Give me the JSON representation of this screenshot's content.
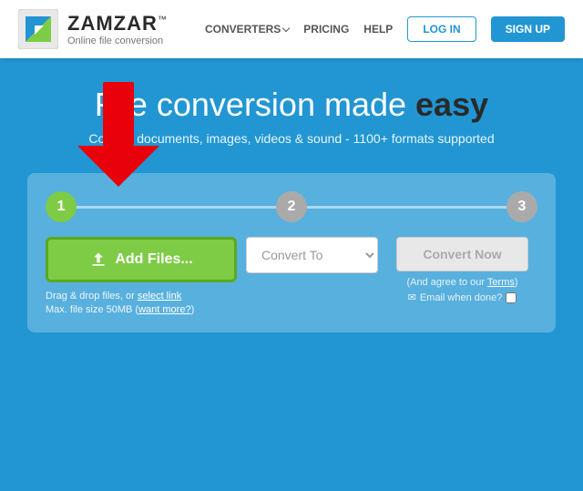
{
  "navbar": {
    "brand": "ZAMZAR",
    "trademark": "™",
    "tagline": "Online file conversion",
    "nav": {
      "converters": "CONVERTERS",
      "pricing": "PRICING",
      "help": "HELP",
      "login": "LOG IN",
      "signup": "SIGN UP"
    }
  },
  "hero": {
    "title_part1": "File ",
    "title_part2": "conversion made ",
    "title_accent": "easy",
    "subtitle": "Convert documents, images, videos & sound - 1100+ formats supported"
  },
  "converter": {
    "step1_num": "1",
    "step2_num": "2",
    "step3_num": "3",
    "add_files_label": "Add Files...",
    "drag_line1": "Drag & drop files, or",
    "drag_link": "select link",
    "drag_line2": "Max. file size 50MB (",
    "drag_want_more": "want more?",
    "drag_close": ")",
    "convert_to_placeholder": "Convert To",
    "convert_now_label": "Convert Now",
    "agree_text": "(And agree to our",
    "terms_link": "Terms",
    "agree_close": ")",
    "email_label": "Email when done?",
    "upload_icon": "↑"
  }
}
